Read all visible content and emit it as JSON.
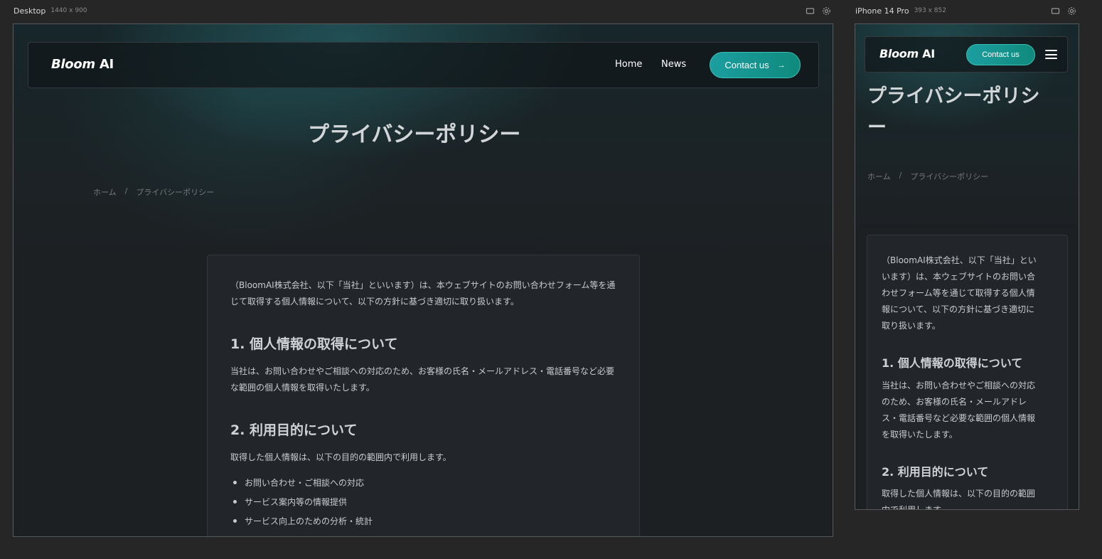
{
  "frames": {
    "desktop": {
      "label": "Desktop",
      "dims": "1440 x 900"
    },
    "mobile": {
      "label": "iPhone 14 Pro",
      "dims": "393 x 852"
    }
  },
  "brand": {
    "name_italic": "Bloom",
    "name_rest": " AI"
  },
  "nav": {
    "home": "Home",
    "news": "News",
    "contact": "Contact us",
    "contact_arrow": "→"
  },
  "page": {
    "title": "プライバシーポリシー",
    "breadcrumb": {
      "home": "ホーム",
      "sep": "/",
      "current": "プライバシーポリシー"
    }
  },
  "content": {
    "intro": "（BloomAI株式会社、以下「当社」といいます）は、本ウェブサイトのお問い合わせフォーム等を通じて取得する個人情報について、以下の方針に基づき適切に取り扱います。",
    "s1_title": "1. 個人情報の取得について",
    "s1_body": "当社は、お問い合わせやご相談への対応のため、お客様の氏名・メールアドレス・電話番号など必要な範囲の個人情報を取得いたします。",
    "s2_title": "2. 利用目的について",
    "s2_body": "取得した個人情報は、以下の目的の範囲内で利用します。",
    "s2_items": [
      "お問い合わせ・ご相談への対応",
      "サービス案内等の情報提供",
      "サービス向上のための分析・統計"
    ]
  },
  "mobile_intro_lines": [
    "（BloomAI株式会社、以下「当社」とい",
    "います）は、本ウェブサイトのお問い合",
    "わせフォーム等を通じて取得する個人情",
    "報について、以下の方針に基づき適切に",
    "取り扱います。"
  ],
  "mobile_s1_lines": [
    "当社は、お問い合わせやご相談への対応",
    "のため、お客様の氏名・メールアドレ",
    "ス・電話番号など必要な範囲の個人情報",
    "を取得いたします。"
  ],
  "mobile_s2_lines": [
    "取得した個人情報は、以下の目的の範囲",
    "内で利用します。"
  ],
  "mobile_title_lines": [
    "プライバシーポリシ",
    "ー"
  ],
  "colors": {
    "accent": "#1c9ea0",
    "background": "#1d2023",
    "card": "#22262a"
  }
}
